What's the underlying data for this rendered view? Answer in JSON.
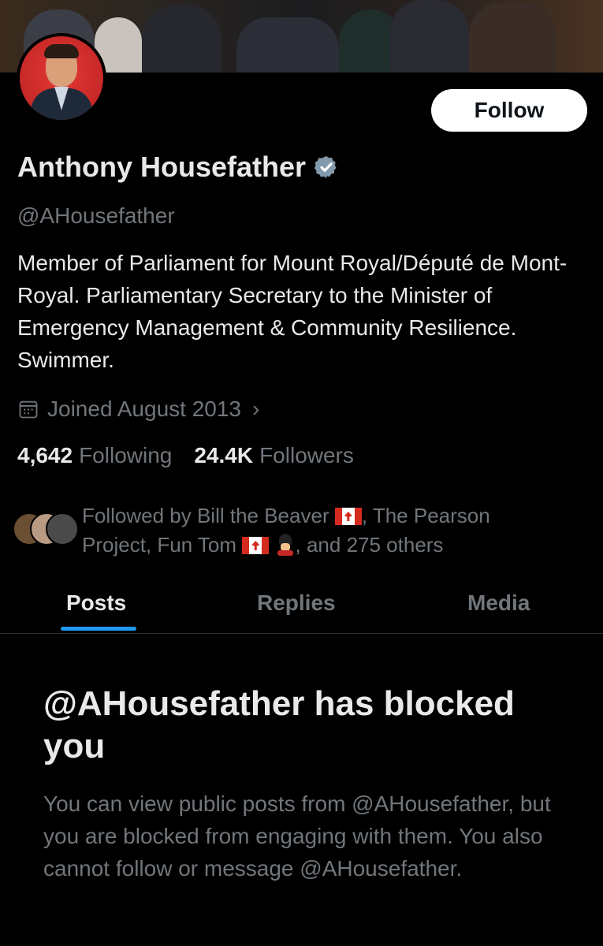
{
  "profile": {
    "display_name": "Anthony Housefather",
    "handle": "@AHousefather",
    "bio": "Member of Parliament for Mount Royal/Député de Mont-Royal. Parliamentary Secretary to the Minister of Emergency Management & Community Resilience. Swimmer.",
    "joined": "Joined August 2013",
    "following_count": "4,642",
    "following_label": "Following",
    "followers_count": "24.4K",
    "followers_label": "Followers"
  },
  "actions": {
    "follow_label": "Follow"
  },
  "followed_by": {
    "prefix": "Followed by Bill the Beaver",
    "middle": ", The Pearson Project, Fun Tom",
    "suffix": ", and 275 others"
  },
  "tabs": [
    {
      "label": "Posts"
    },
    {
      "label": "Replies"
    },
    {
      "label": "Media"
    }
  ],
  "blocked": {
    "title": "@AHousefather has blocked you",
    "message": "You can view public posts from @AHousefather, but you are blocked from engaging with them. You also cannot follow or message @AHousefather."
  },
  "icons": {
    "verified": "verified-badge-icon",
    "calendar": "calendar-icon",
    "chevron": "chevron-right-icon"
  },
  "colors": {
    "accent": "#1d9bf0",
    "background": "#000000",
    "text_primary": "#e7e9ea",
    "text_secondary": "#71767b"
  }
}
